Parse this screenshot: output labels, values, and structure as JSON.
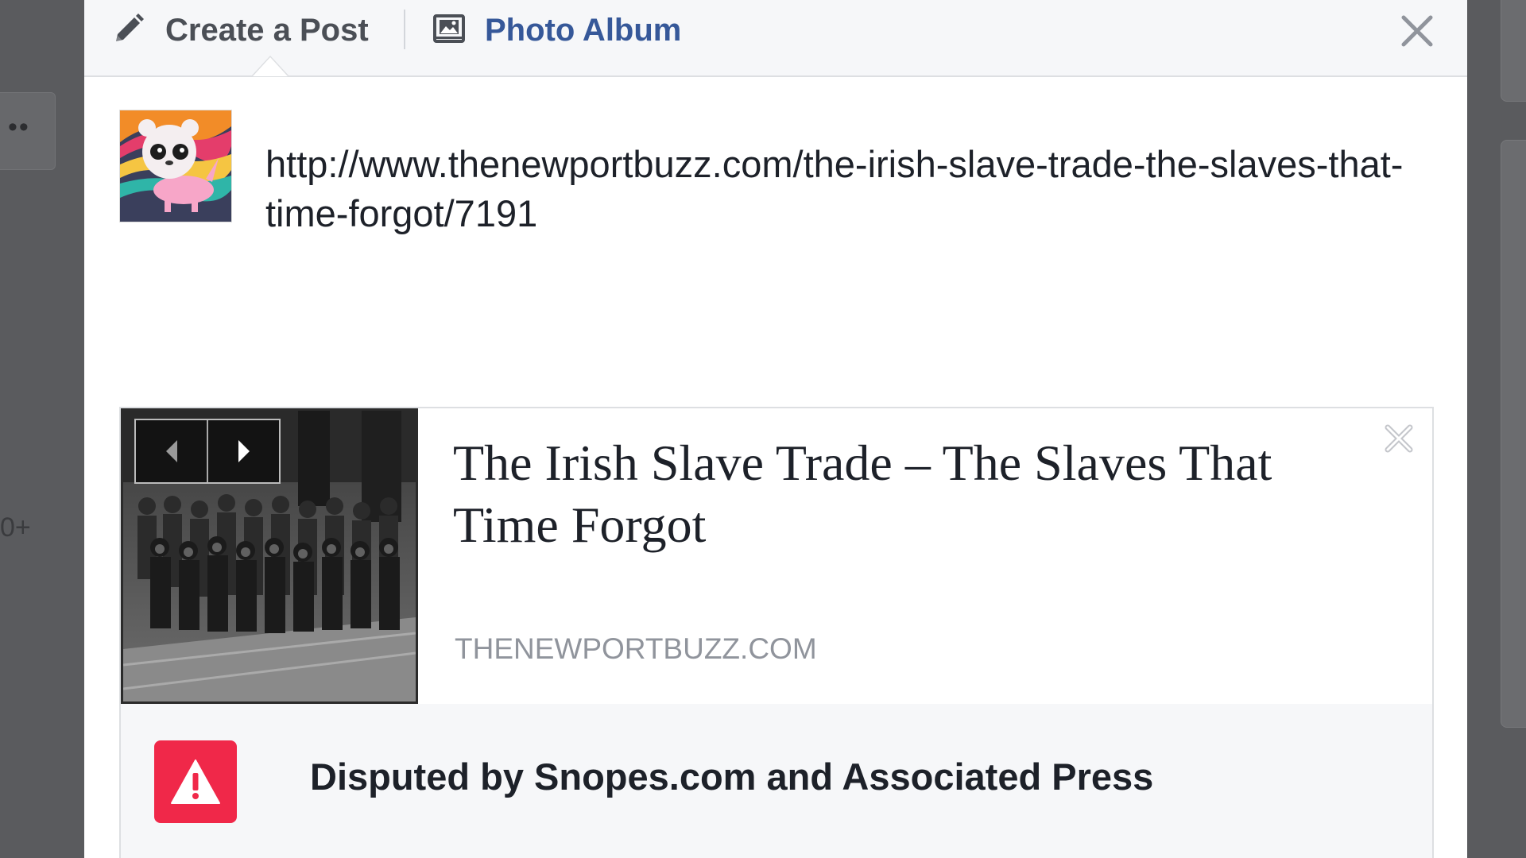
{
  "background": {
    "left_card_text": "••",
    "left_count_text": "0+"
  },
  "dialog": {
    "tabs": [
      {
        "label": "Create a Post",
        "icon": "pencil-icon",
        "color": "#4b4f56"
      },
      {
        "label": "Photo Album",
        "icon": "photo-album-icon",
        "color": "#365899"
      }
    ],
    "close_icon": "close-icon",
    "post_text": "http://www.thenewportbuzz.com/the-irish-slave-trade-the-slaves-that-time-forgot/7191",
    "link_preview": {
      "title": "The Irish Slave Trade – The Slaves That Time Forgot",
      "domain": "THENEWPORTBUZZ.COM",
      "prev_icon": "chevron-left-icon",
      "next_icon": "chevron-right-icon",
      "remove_icon": "close-icon"
    },
    "dispute": {
      "text": "Disputed by Snopes.com and Associated Press",
      "icon": "warning-icon",
      "badge_color": "#f02849"
    }
  }
}
